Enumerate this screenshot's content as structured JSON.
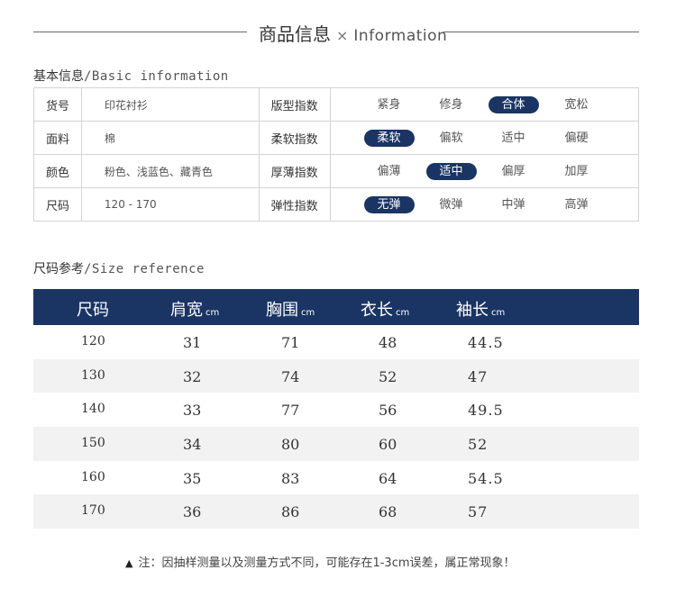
{
  "header": {
    "title_cn": "商品信息",
    "separator": "×",
    "title_en": "Information"
  },
  "basic": {
    "label_cn": "基本信息",
    "label_en": "/Basic information",
    "rows": [
      {
        "k1": "货号",
        "v1": "印花衬衫",
        "k2": "版型指数",
        "options": [
          "紧身",
          "修身",
          "合体",
          "宽松"
        ],
        "selected": 2
      },
      {
        "k1": "面料",
        "v1": "棉",
        "k2": "柔软指数",
        "options": [
          "柔软",
          "偏软",
          "适中",
          "偏硬"
        ],
        "selected": 0
      },
      {
        "k1": "颜色",
        "v1": "粉色、浅蓝色、藏青色",
        "k2": "厚薄指数",
        "options": [
          "偏薄",
          "适中",
          "偏厚",
          "加厚"
        ],
        "selected": 1
      },
      {
        "k1": "尺码",
        "v1": "120 - 170",
        "k2": "弹性指数",
        "options": [
          "无弹",
          "微弹",
          "中弹",
          "高弹"
        ],
        "selected": 0
      }
    ]
  },
  "size": {
    "label_cn": "尺码参考",
    "label_en": "/Size reference",
    "headers": [
      {
        "label": "尺码",
        "unit": ""
      },
      {
        "label": "肩宽",
        "unit": "cm"
      },
      {
        "label": "胸围",
        "unit": "cm"
      },
      {
        "label": "衣长",
        "unit": "cm"
      },
      {
        "label": "袖长",
        "unit": "cm"
      }
    ],
    "rows": [
      [
        "120",
        "31",
        "71",
        "48",
        "44.5"
      ],
      [
        "130",
        "32",
        "74",
        "52",
        "47"
      ],
      [
        "140",
        "33",
        "77",
        "56",
        "49.5"
      ],
      [
        "150",
        "34",
        "80",
        "60",
        "52"
      ],
      [
        "160",
        "35",
        "83",
        "64",
        "54.5"
      ],
      [
        "170",
        "36",
        "86",
        "68",
        "57"
      ]
    ]
  },
  "note": {
    "icon": "warning-icon",
    "text": "注：因抽样测量以及测量方式不同，可能存在1-3cm误差，属正常现象！"
  },
  "colors": {
    "accent": "#1a3563",
    "row_shade": "#f2f2f2",
    "border": "#d4d4d4"
  }
}
